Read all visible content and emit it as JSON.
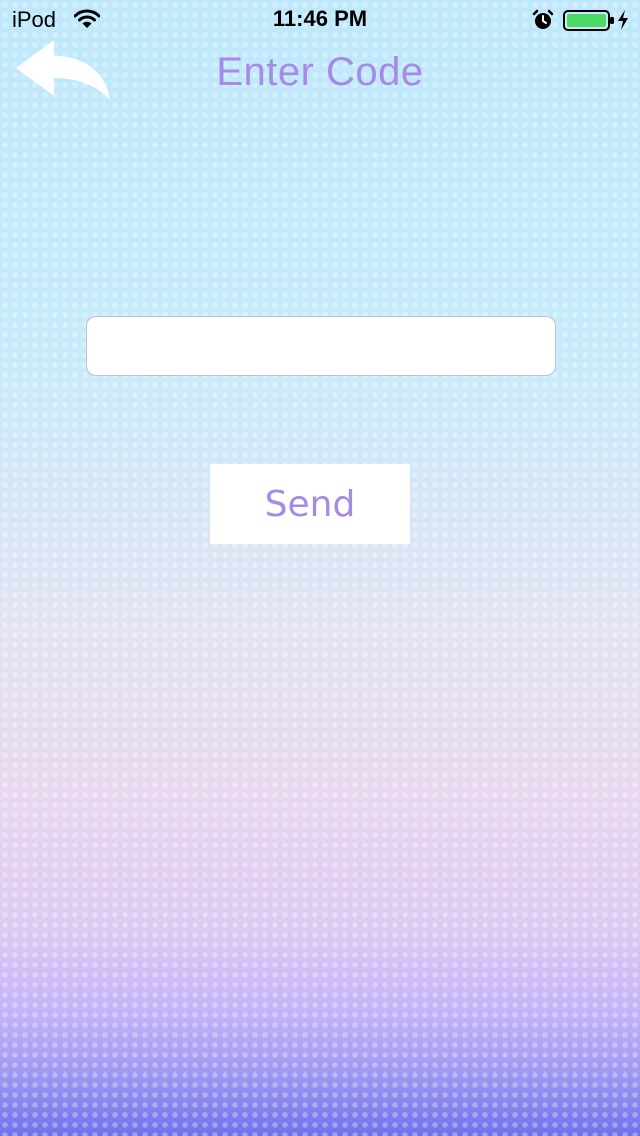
{
  "status_bar": {
    "carrier": "iPod",
    "time": "11:46 PM",
    "icons": [
      "wifi-icon",
      "alarm-icon",
      "battery-icon",
      "charging-icon"
    ],
    "battery_color": "#4cd964"
  },
  "nav": {
    "title": "Enter Code",
    "back_icon": "back-arrow-icon"
  },
  "form": {
    "code_value": "",
    "code_placeholder": "",
    "send_label": "Send"
  },
  "colors": {
    "accent": "#a58ae6",
    "background_top": "#bfe8fb",
    "background_bottom": "#6f73ea"
  }
}
